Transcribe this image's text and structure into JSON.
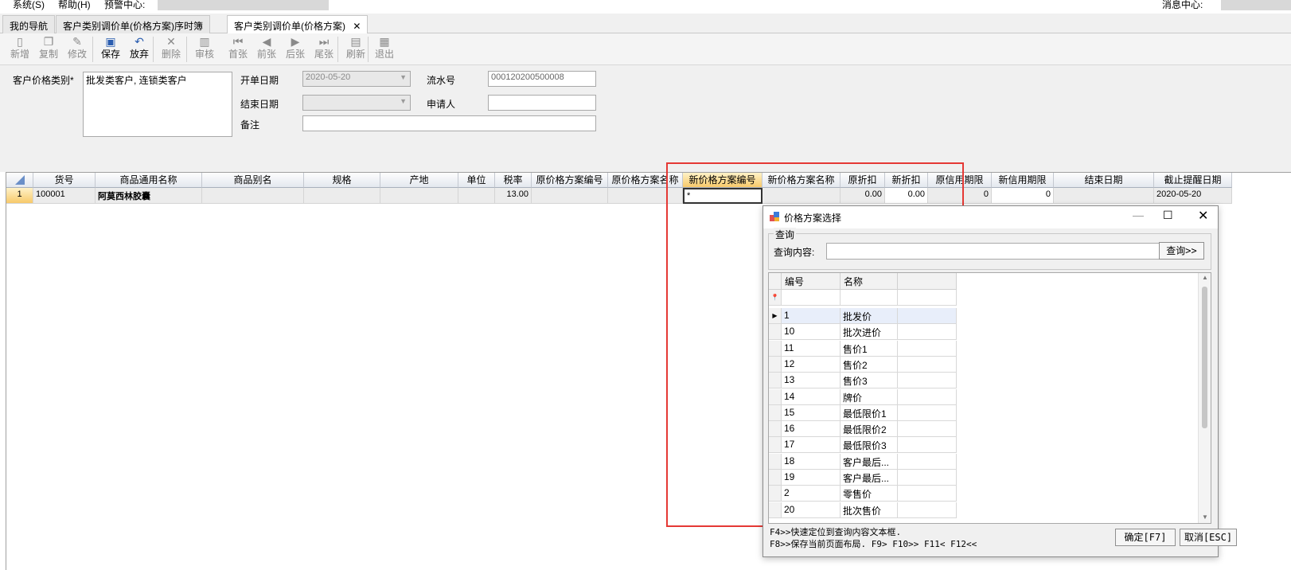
{
  "menu": {
    "system": "系统(S)",
    "help": "帮助(H)",
    "alert_center": "预警中心:",
    "message_center": "消息中心:"
  },
  "tabs": [
    "我的导航",
    "客户类别调价单(价格方案)序时簿",
    "客户类别调价单(价格方案)"
  ],
  "tab_close": "✕",
  "toolbar": [
    {
      "label": "新增",
      "icon": "new-doc-icon",
      "enabled": false
    },
    {
      "label": "复制",
      "icon": "copy-icon",
      "enabled": false
    },
    {
      "label": "修改",
      "icon": "edit-icon",
      "enabled": false
    },
    {
      "label": "保存",
      "icon": "save-icon",
      "enabled": true
    },
    {
      "label": "放弃",
      "icon": "undo-icon",
      "enabled": true
    },
    {
      "label": "删除",
      "icon": "delete-icon",
      "enabled": false
    },
    {
      "label": "审核",
      "icon": "audit-icon",
      "enabled": false
    },
    {
      "label": "首张",
      "icon": "first-icon",
      "enabled": false
    },
    {
      "label": "前张",
      "icon": "prev-icon",
      "enabled": false
    },
    {
      "label": "后张",
      "icon": "next-icon",
      "enabled": false
    },
    {
      "label": "尾张",
      "icon": "last-icon",
      "enabled": false
    },
    {
      "label": "刷新",
      "icon": "refresh-icon",
      "enabled": false
    },
    {
      "label": "退出",
      "icon": "exit-icon",
      "enabled": false
    }
  ],
  "form": {
    "customer_category_label": "客户价格类别*",
    "customer_category_value": "批发类客户, 连锁类客户",
    "start_date_label": "开单日期",
    "start_date_value": "2020-05-20",
    "serial_label": "流水号",
    "serial_value": "000120200500008",
    "end_date_label": "结束日期",
    "end_date_value": "",
    "applicant_label": "申请人",
    "applicant_value": "",
    "remark_label": "备注",
    "remark_value": ""
  },
  "grid": {
    "columns": [
      "货号",
      "商品通用名称",
      "商品别名",
      "规格",
      "产地",
      "单位",
      "税率",
      "原价格方案编号",
      "原价格方案名称",
      "新价格方案编号",
      "新价格方案名称",
      "原折扣",
      "新折扣",
      "原信用期限",
      "新信用期限",
      "结束日期",
      "截止提醒日期"
    ],
    "rows": [
      {
        "num": "1",
        "cells": [
          "100001",
          "阿莫西林胶囊",
          "",
          "",
          "",
          "",
          "13.00",
          "",
          "",
          "*",
          "",
          "0.00",
          "0.00",
          "0",
          "0",
          "",
          "2020-05-20"
        ]
      }
    ]
  },
  "dialog": {
    "title": "价格方案选择",
    "group_label": "查询",
    "query_label": "查询内容:",
    "query_value": "",
    "query_button": "查询>>",
    "columns": [
      "编号",
      "名称"
    ],
    "rows": [
      {
        "code": "1",
        "name": "批发价"
      },
      {
        "code": "10",
        "name": "批次进价"
      },
      {
        "code": "11",
        "name": "售价1"
      },
      {
        "code": "12",
        "name": "售价2"
      },
      {
        "code": "13",
        "name": "售价3"
      },
      {
        "code": "14",
        "name": "牌价"
      },
      {
        "code": "15",
        "name": "最低限价1"
      },
      {
        "code": "16",
        "name": "最低限价2"
      },
      {
        "code": "17",
        "name": "最低限价3"
      },
      {
        "code": "18",
        "name": "客户最后..."
      },
      {
        "code": "19",
        "name": "客户最后..."
      },
      {
        "code": "2",
        "name": "零售价"
      },
      {
        "code": "20",
        "name": "批次售价"
      }
    ],
    "hint1": "F4>>快速定位到查询内容文本框.",
    "hint2": "F8>>保存当前页面布局. F9> F10>> F11< F12<<",
    "ok_button": "确定[F7]",
    "cancel_button": "取消[ESC]"
  }
}
